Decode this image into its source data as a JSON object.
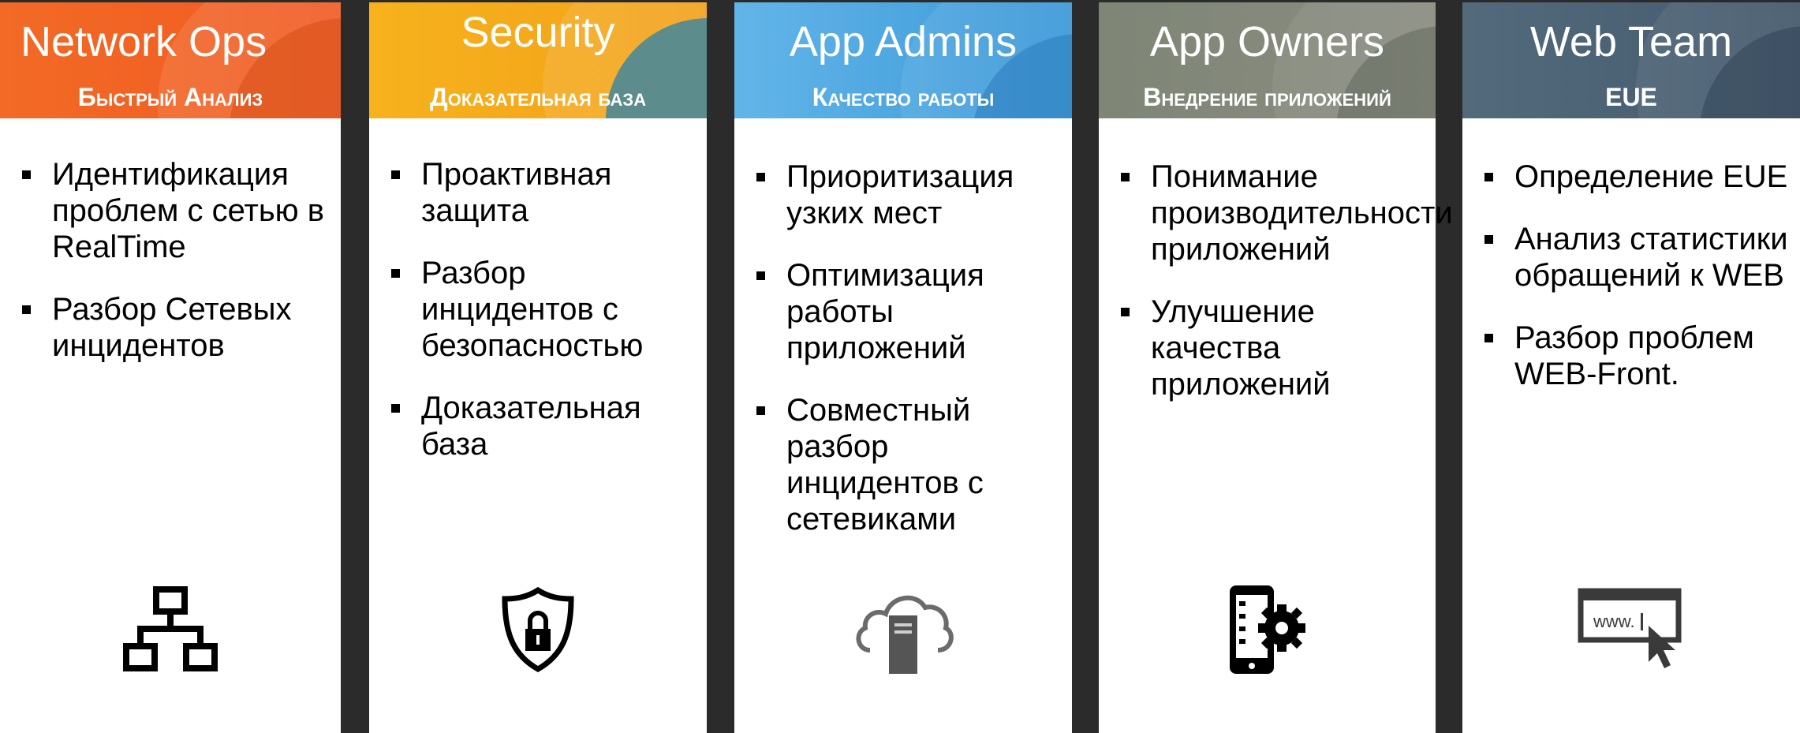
{
  "columns": [
    {
      "title": "Network Ops",
      "subtitle": "Быстрый Анализ",
      "bullets": [
        "Идентификация проблем с сетью в RealTime",
        "Разбор Сетевых инцидентов"
      ],
      "icon": "network-topology-icon",
      "color": "#f06523"
    },
    {
      "title": "Security",
      "subtitle": "Доказательная база",
      "bullets": [
        "Проактивная защита",
        "Разбор инцидентов с безопасностью",
        "Доказательная база"
      ],
      "icon": "shield-lock-icon",
      "color": "#f5ac1a"
    },
    {
      "title": "App Admins",
      "subtitle": "Качество работы",
      "bullets": [
        "Приоритизация узких мест",
        "Оптимизация работы приложений",
        "Совместный разбор инцидентов с сетевиками"
      ],
      "icon": "cloud-server-icon",
      "color": "#4aa8e0"
    },
    {
      "title": "App Owners",
      "subtitle": "Внедрение приложений",
      "bullets": [
        "Понимание производительности приложений",
        "Улучшение качества приложений"
      ],
      "icon": "mobile-settings-icon",
      "color": "#828878"
    },
    {
      "title": "Web Team",
      "subtitle": "EUE",
      "bullets": [
        "Определение EUE",
        "Анализ статистики обращений к WEB",
        "Разбор проблем WEB-Front."
      ],
      "icon": "web-browser-cursor-icon",
      "color": "#4d6478"
    }
  ],
  "web_icon_text": "www."
}
